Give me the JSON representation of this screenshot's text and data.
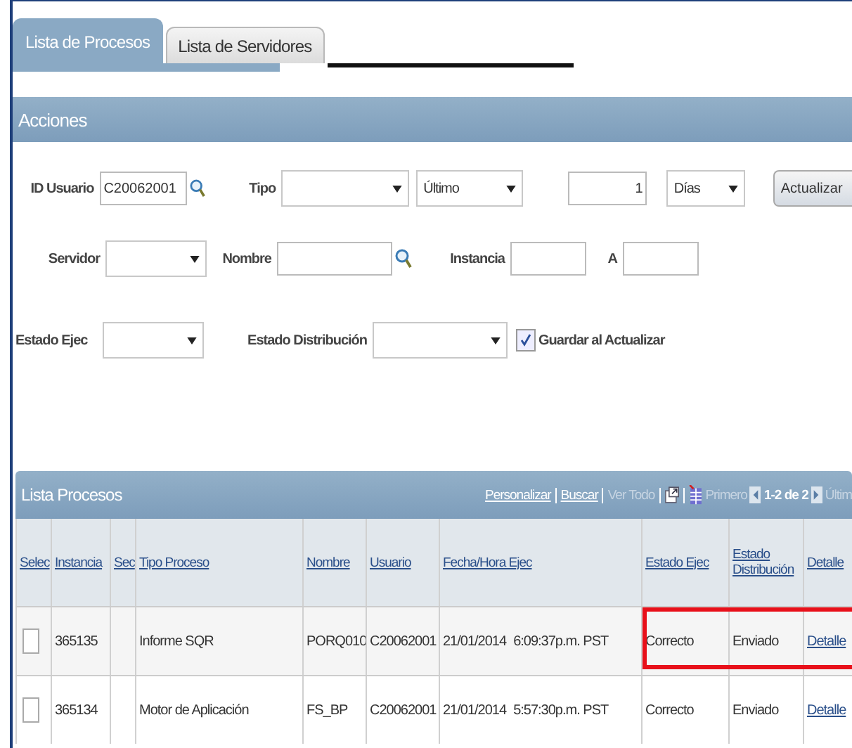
{
  "tabs": [
    {
      "label": "Lista de Procesos",
      "selected": true
    },
    {
      "label": "Lista de Servidores",
      "selected": false
    }
  ],
  "actions": {
    "title": "Acciones",
    "user_id": {
      "label": "ID Usuario",
      "value": "C20062001"
    },
    "type": {
      "label": "Tipo"
    },
    "range": {
      "value": "Último"
    },
    "count": {
      "value": "1"
    },
    "unit": {
      "value": "Días"
    },
    "refresh_button": "Actualizar",
    "server": {
      "label": "Servidor"
    },
    "name": {
      "label": "Nombre"
    },
    "instance": {
      "label": "Instancia"
    },
    "to": {
      "label": "A"
    },
    "run_status": {
      "label": "Estado Ejec"
    },
    "dist_status": {
      "label": "Estado Distribución"
    },
    "save_on_refresh": {
      "label": "Guardar al Actualizar",
      "checked": true
    }
  },
  "process_list": {
    "title": "Lista Procesos",
    "links": [
      {
        "label": "Personalizar",
        "disabled": false
      },
      {
        "label": "Buscar",
        "disabled": false
      },
      {
        "label": "Ver Todo",
        "disabled": true
      }
    ],
    "first": "Primero",
    "pager": "1-2 de 2",
    "last": "Últim",
    "columns": [
      "Selec",
      "Instancia",
      "Sec",
      "Tipo Proceso",
      "Nombre",
      "Usuario",
      "Fecha/Hora Ejec",
      "Estado Ejec",
      "Estado Distribución",
      "Detalle"
    ],
    "rows": [
      {
        "checked": false,
        "highlighted": true,
        "instance": "365135",
        "type": "Informe SQR",
        "name": "PORQ010",
        "user": "C20062001",
        "date": "21/01/2014",
        "time": "6:09:37p.m. PST",
        "run_status": "Correcto",
        "dist_status": "Enviado",
        "detail": "Detalle"
      },
      {
        "checked": false,
        "highlighted": false,
        "instance": "365134",
        "type": "Motor de Aplicación",
        "name": "FS_BP",
        "user": "C20062001",
        "date": "21/01/2014",
        "time": "5:57:30p.m. PST",
        "run_status": "Correcto",
        "dist_status": "Enviado",
        "detail": "Detalle"
      }
    ]
  }
}
